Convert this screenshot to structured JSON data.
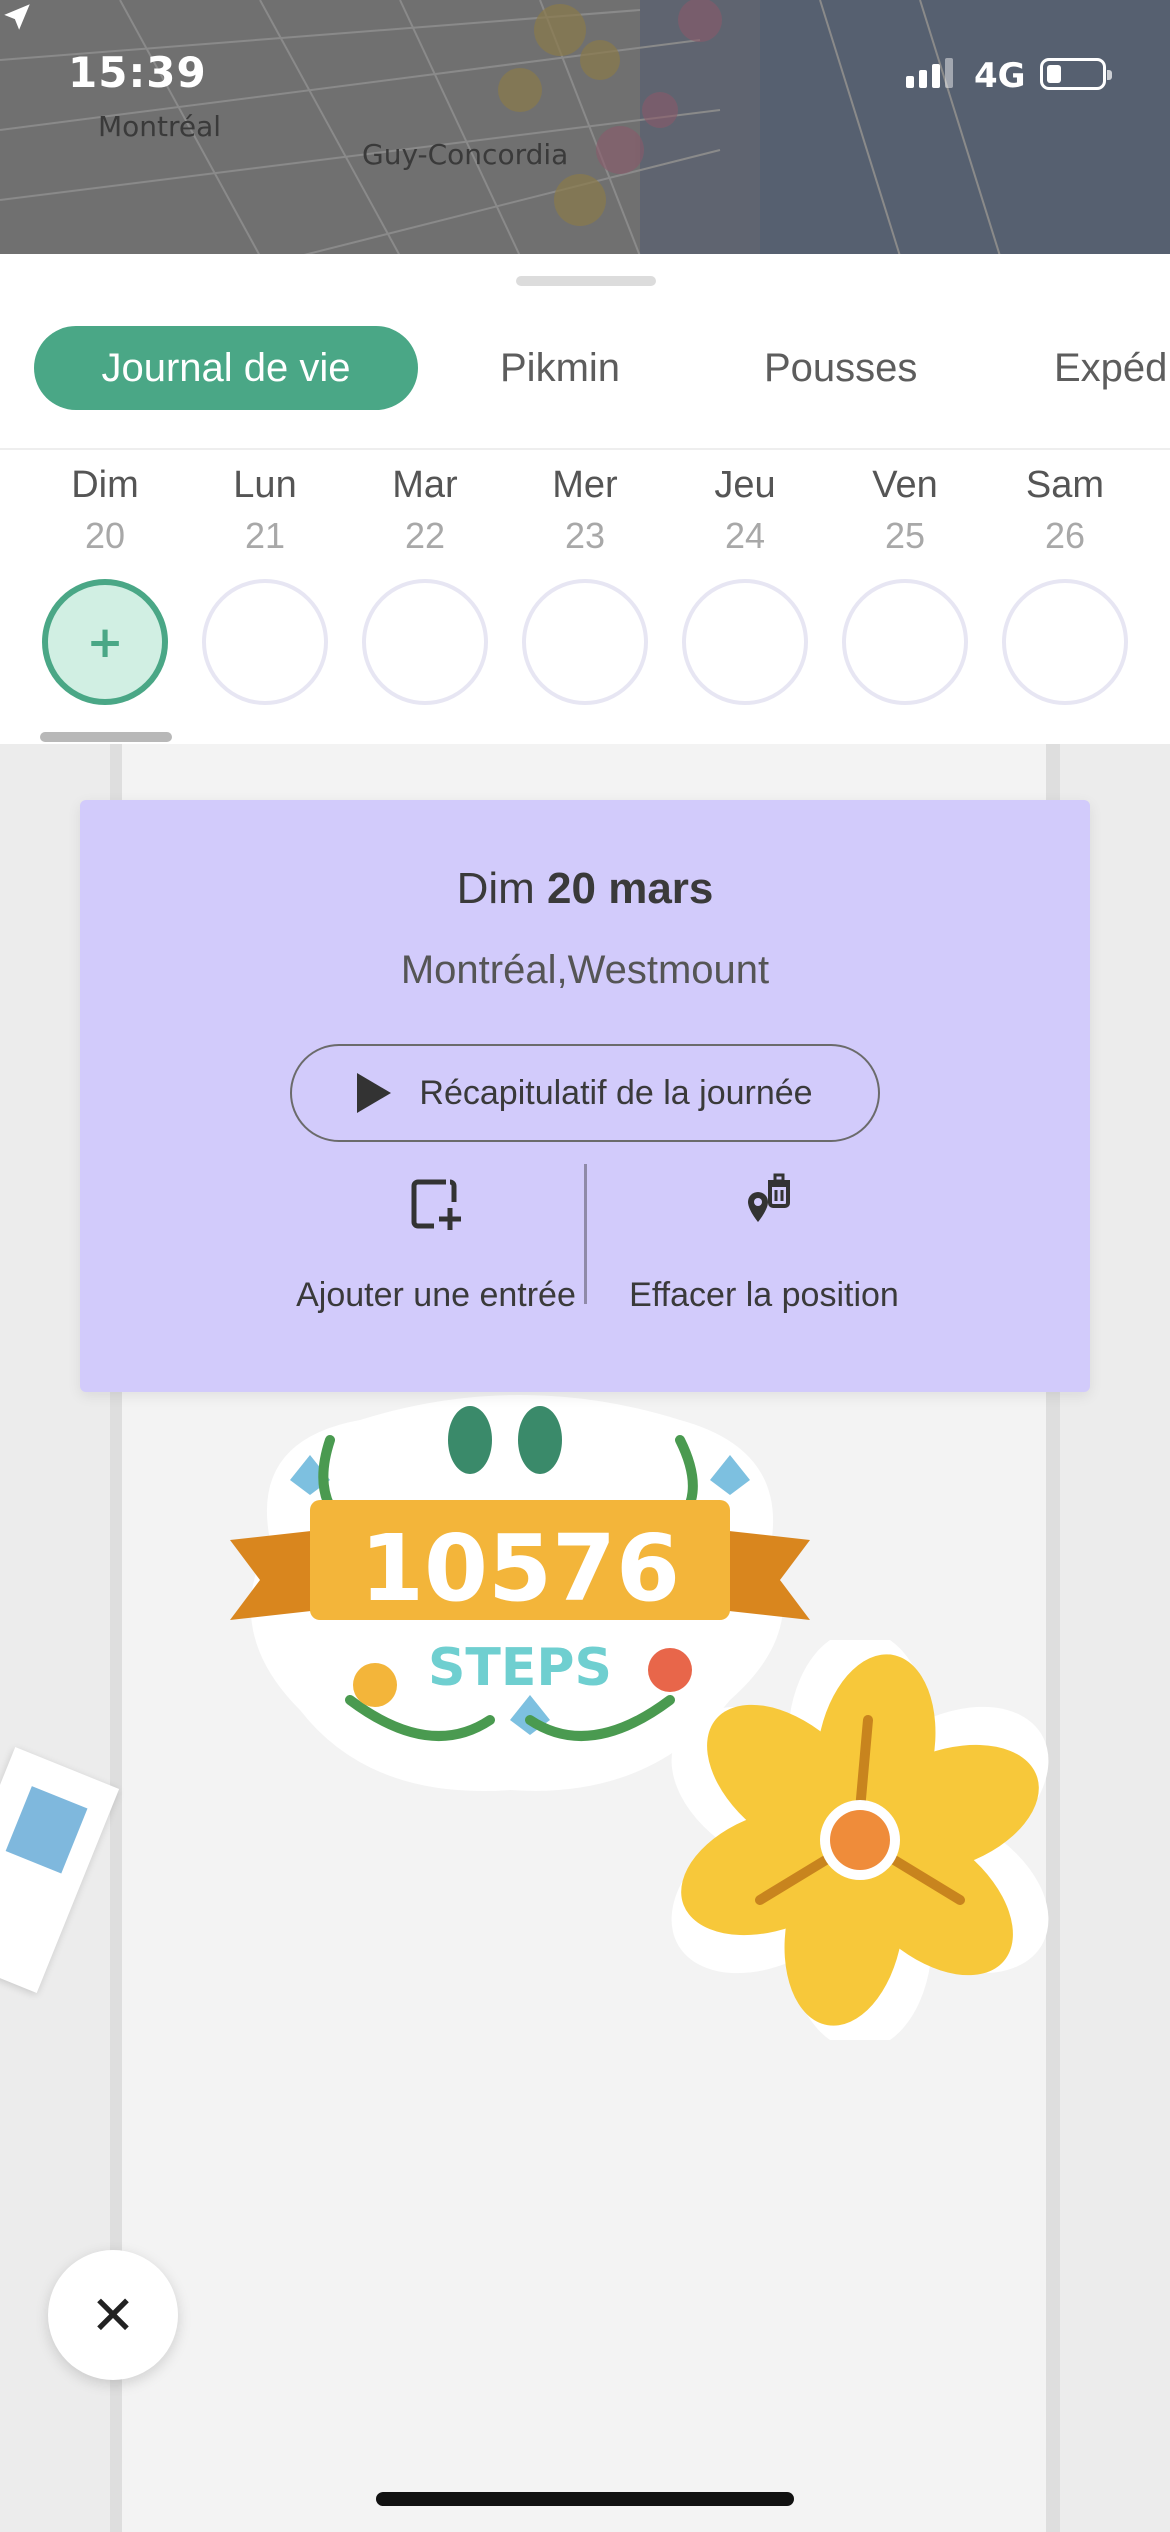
{
  "status": {
    "time": "15:39",
    "network": "4G"
  },
  "map": {
    "labels": [
      "Montréal",
      "Guy-Concordia"
    ]
  },
  "tabs": [
    {
      "label": "Journal de vie",
      "active": true
    },
    {
      "label": "Pikmin",
      "active": false
    },
    {
      "label": "Pousses",
      "active": false
    },
    {
      "label": "Expéd",
      "active": false
    }
  ],
  "week": [
    {
      "name": "Dim",
      "num": "20",
      "selected": true
    },
    {
      "name": "Lun",
      "num": "21",
      "selected": false
    },
    {
      "name": "Mar",
      "num": "22",
      "selected": false
    },
    {
      "name": "Mer",
      "num": "23",
      "selected": false
    },
    {
      "name": "Jeu",
      "num": "24",
      "selected": false
    },
    {
      "name": "Ven",
      "num": "25",
      "selected": false
    },
    {
      "name": "Sam",
      "num": "26",
      "selected": false
    }
  ],
  "card": {
    "day": "Dim",
    "date": "20 mars",
    "location": "Montréal,Westmount",
    "recap_label": "Récapitulatif de la journée",
    "add_entry_label": "Ajouter une entrée",
    "clear_location_label": "Effacer la position"
  },
  "stickers": {
    "steps_value": "10576",
    "steps_label": "STEPS"
  },
  "icons": {
    "close": "close-icon",
    "add": "plus-icon",
    "play": "play-icon",
    "add_entry": "add-entry-icon",
    "clear_location": "location-trash-icon"
  },
  "colors": {
    "accent_green": "#4aa786",
    "card_purple": "#d2cbfb",
    "selected_day_fill": "#d1efe3"
  }
}
